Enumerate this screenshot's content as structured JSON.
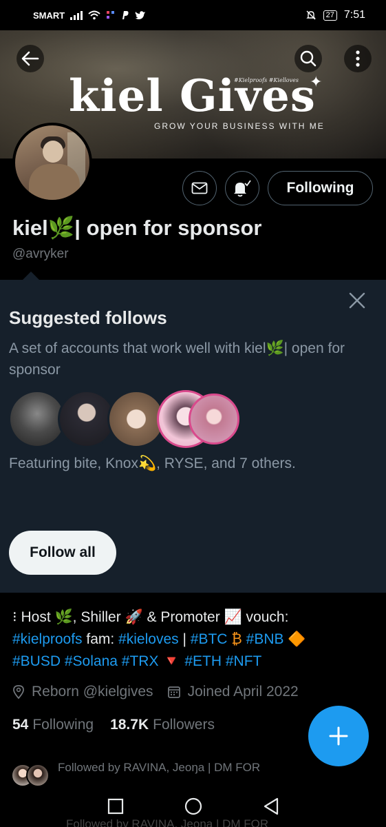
{
  "status_bar": {
    "carrier": "SMART",
    "battery": "27",
    "time": "7:51"
  },
  "banner": {
    "title": "kiel Gives",
    "tags": "#Kielproofs #Kielloves",
    "tagline": "GROW YOUR BUSINESS WITH ME"
  },
  "header": {
    "back_icon": "arrow-left-icon",
    "search_icon": "search-icon",
    "more_icon": "more-vertical-icon"
  },
  "profile": {
    "display_name": "kiel🌿| open for sponsor",
    "handle": "@avryker",
    "following_button": "Following"
  },
  "suggested": {
    "title": "Suggested follows",
    "description": "A set of accounts that work well with kiel🌿| open for sponsor",
    "featuring": "Featuring bite, Knox💫, RYSE, and 7 others.",
    "follow_all": "Follow all",
    "avatars": [
      "#3c3c3c",
      "#2b2a33",
      "#8a6d55",
      "#d98aa6",
      "#d9a3c1"
    ]
  },
  "bio": {
    "prefix": "⁝ Host 🌿, Shiller 🚀 & Promoter 📈 vouch:",
    "tag1": "#kielproofs",
    "fam": " fam: ",
    "tag2": "#kieloves",
    "sep": " | ",
    "tag3": "#BTC",
    "btc_emoji": " ₿ ",
    "tag4": "#BNB",
    "bnb_emoji": " 🔶",
    "tag5": "#BUSD",
    "tag6": "#Solana",
    "tag7": "#TRX",
    "trx_emoji": " 🔻 ",
    "tag8": "#ETH",
    "tag9": "#NFT"
  },
  "meta": {
    "location": "Reborn @kielgives",
    "joined": "Joined April 2022"
  },
  "stats": {
    "following_count": "54",
    "following_label": "Following",
    "followers_count": "18.7K",
    "followers_label": "Followers"
  },
  "followed_by": "Followed by RAVINA, Jeoŋa | DM FOR",
  "followed_by_ghost": "Followed by RAVINA, Jeoŋa | DM FOR",
  "colors": {
    "accent": "#1d9bf0",
    "panel": "#16202b",
    "muted": "#71767b"
  }
}
